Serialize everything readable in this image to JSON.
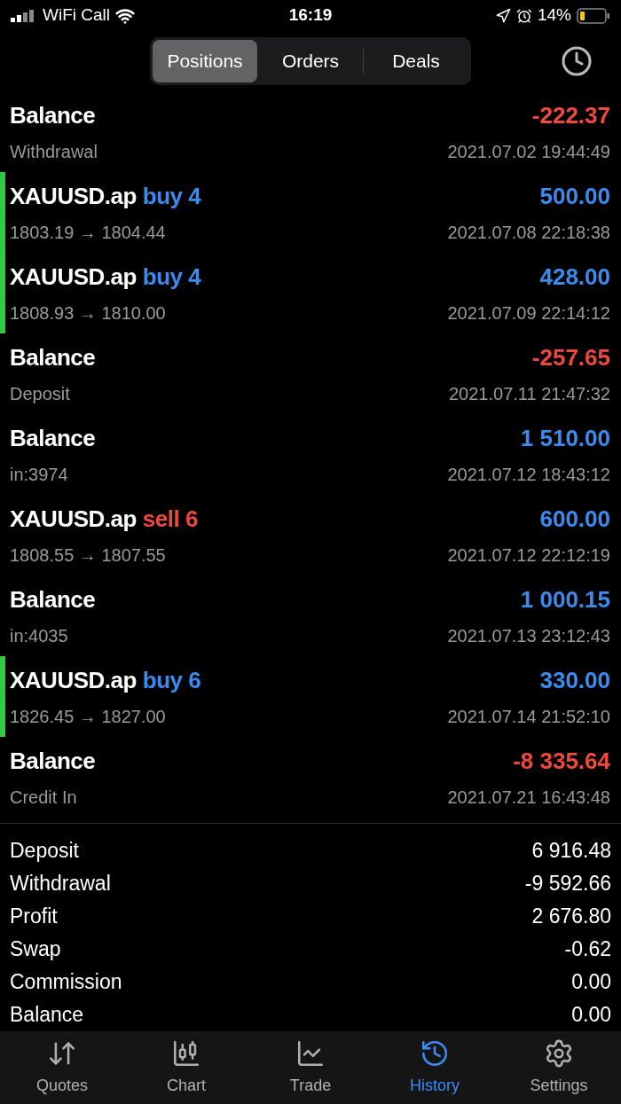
{
  "status_bar": {
    "carrier": "WiFi Call",
    "time": "16:19",
    "battery": "14%"
  },
  "segments": [
    {
      "label": "Positions",
      "selected": true
    },
    {
      "label": "Orders",
      "selected": false
    },
    {
      "label": "Deals",
      "selected": false
    }
  ],
  "deals": [
    {
      "title": "Balance",
      "amount": {
        "text": "-222.37",
        "kind": "negative"
      },
      "detail": "Withdrawal",
      "time": "2021.07.02 19:44:49",
      "marked": false
    },
    {
      "title": "XAUUSD.ap",
      "side": {
        "text": "buy 4",
        "kind": "buy"
      },
      "amount": {
        "text": "500.00",
        "kind": "positive"
      },
      "detail": "1803.19 → 1804.44",
      "time": "2021.07.08 22:18:38",
      "marked": true
    },
    {
      "title": "XAUUSD.ap",
      "side": {
        "text": "buy 4",
        "kind": "buy"
      },
      "amount": {
        "text": "428.00",
        "kind": "positive"
      },
      "detail": "1808.93 → 1810.00",
      "time": "2021.07.09 22:14:12",
      "marked": true
    },
    {
      "title": "Balance",
      "amount": {
        "text": "-257.65",
        "kind": "negative"
      },
      "detail": "Deposit",
      "time": "2021.07.11 21:47:32",
      "marked": false
    },
    {
      "title": "Balance",
      "amount": {
        "text": "1 510.00",
        "kind": "positive"
      },
      "detail": "in:3974",
      "time": "2021.07.12 18:43:12",
      "marked": false
    },
    {
      "title": "XAUUSD.ap",
      "side": {
        "text": "sell 6",
        "kind": "sell"
      },
      "amount": {
        "text": "600.00",
        "kind": "positive"
      },
      "detail": "1808.55 → 1807.55",
      "time": "2021.07.12 22:12:19",
      "marked": false
    },
    {
      "title": "Balance",
      "amount": {
        "text": "1 000.15",
        "kind": "positive"
      },
      "detail": "in:4035",
      "time": "2021.07.13 23:12:43",
      "marked": false
    },
    {
      "title": "XAUUSD.ap",
      "side": {
        "text": "buy 6",
        "kind": "buy"
      },
      "amount": {
        "text": "330.00",
        "kind": "positive"
      },
      "detail": "1826.45 → 1827.00",
      "time": "2021.07.14 21:52:10",
      "marked": true
    },
    {
      "title": "Balance",
      "amount": {
        "text": "-8 335.64",
        "kind": "negative"
      },
      "detail": "Credit In",
      "time": "2021.07.21 16:43:48",
      "marked": false
    }
  ],
  "summary": [
    {
      "label": "Deposit",
      "value": "6 916.48"
    },
    {
      "label": "Withdrawal",
      "value": "-9 592.66"
    },
    {
      "label": "Profit",
      "value": "2 676.80"
    },
    {
      "label": "Swap",
      "value": "-0.62"
    },
    {
      "label": "Commission",
      "value": "0.00"
    },
    {
      "label": "Balance",
      "value": "0.00"
    }
  ],
  "tab_bar": [
    {
      "label": "Quotes",
      "kind": "quotes",
      "selected": false
    },
    {
      "label": "Chart",
      "kind": "chart",
      "selected": false
    },
    {
      "label": "Trade",
      "kind": "trade",
      "selected": false
    },
    {
      "label": "History",
      "kind": "history",
      "selected": true
    },
    {
      "label": "Settings",
      "kind": "settings",
      "selected": false
    }
  ]
}
